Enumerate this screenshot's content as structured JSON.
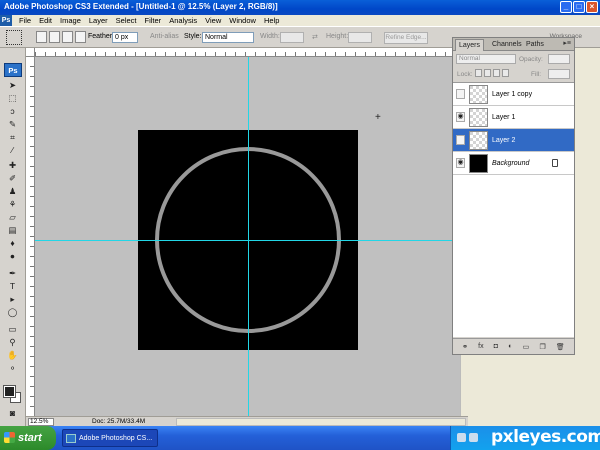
{
  "window": {
    "title": "Adobe Photoshop CS3 Extended - [Untitled-1 @ 12.5% (Layer 2, RGB/8)]"
  },
  "menu": [
    "File",
    "Edit",
    "Image",
    "Layer",
    "Select",
    "Filter",
    "Analysis",
    "View",
    "Window",
    "Help"
  ],
  "options": {
    "feather_label": "Feather:",
    "feather_value": "0 px",
    "antialias_label": "Anti-alias",
    "style_label": "Style:",
    "style_value": "Normal",
    "width_label": "Width:",
    "height_label": "Height:",
    "refine_label": "Refine Edge...",
    "workspace_label": "Workspace"
  },
  "toolbox": {
    "logo": "Ps"
  },
  "status": {
    "zoom": "12.5%",
    "doc": "Doc: 25.7M/33.4M"
  },
  "layers_panel": {
    "tabs": [
      "Layers",
      "Channels",
      "Paths"
    ],
    "blend_mode": "Normal",
    "opacity_label": "Opacity:",
    "lock_label": "Lock:",
    "fill_label": "Fill:",
    "layers": [
      {
        "name": "Layer 1 copy",
        "visible": false,
        "selected": false
      },
      {
        "name": "Layer 1",
        "visible": true,
        "selected": false
      },
      {
        "name": "Layer 2",
        "visible": false,
        "selected": true
      },
      {
        "name": "Background",
        "visible": true,
        "selected": false,
        "locked": true
      }
    ],
    "footer_icons": [
      "link-icon",
      "fx-icon",
      "mask-icon",
      "adjustment-icon",
      "folder-icon",
      "new-layer-icon",
      "trash-icon"
    ]
  },
  "taskbar": {
    "start_label": "start",
    "task_label": "Adobe Photoshop CS...",
    "brand": "pxleyes.com"
  },
  "colors": {
    "guide": "#22d6e6",
    "selection": "#316ac5",
    "ring": "#999999"
  }
}
